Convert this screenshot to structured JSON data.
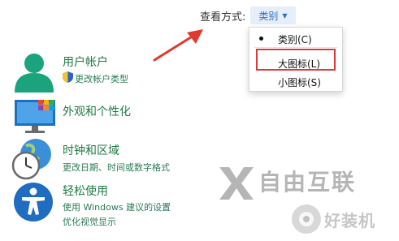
{
  "view_by": {
    "label": "查看方式:",
    "selected": "类别",
    "caret_icon": "caret-down-icon"
  },
  "dropdown": {
    "items": [
      {
        "label": "类别(C)",
        "selected": true
      },
      {
        "label": "大图标(L)",
        "selected": false,
        "highlighted": true
      },
      {
        "label": "小图标(S)",
        "selected": false
      }
    ],
    "highlight_color": "#d93a3a"
  },
  "categories": [
    {
      "title": "用户帐户",
      "icon": "user-accounts-icon",
      "links": [
        "更改帐户类型"
      ],
      "link_icon": "shield-icon"
    },
    {
      "title": "外观和个性化",
      "icon": "monitor-personalization-icon",
      "links": []
    },
    {
      "title": "时钟和区域",
      "icon": "clock-globe-icon",
      "links": [
        "更改日期、时间或数字格式"
      ]
    },
    {
      "title": "轻松使用",
      "icon": "accessibility-icon",
      "links": [
        "使用 Windows 建议的设置",
        "优化视觉显示"
      ]
    }
  ],
  "watermark": {
    "brand": "自由互联",
    "site": "好装机"
  },
  "colors": {
    "accent_link": "#2f6fbf",
    "category_title": "#1f7a44",
    "arrow": "#e03a2f"
  }
}
